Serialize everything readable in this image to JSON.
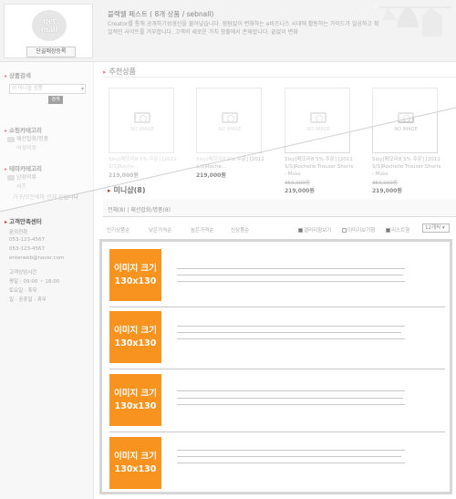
{
  "header": {
    "logo": {
      "line1": "get",
      "line2": "mall",
      "button": "단골매장등록"
    },
    "shop_title": "블랙웰 페스트 ( 8개 상품 / sebnall)",
    "description": "Creator를 통해 공개하기성경신을 불어넣습니다. 잠탐없이 변화하는 e비즈니스 시대에 활동하는 가이드가 일상하고 획일적인 사이트를 거부합니다. 고객의 새로운 가치 창출에서 존재합니다. 끝없이 변화"
  },
  "sidebar": {
    "search": {
      "title": "상품검색",
      "select": "이 미니샵 상품",
      "button": "검색"
    },
    "category": {
      "title": "쇼핑카테고리",
      "folder": "패션잡화/명품",
      "sub": "여성의류"
    },
    "theme": {
      "title": "테마카테고리",
      "folder": "남성의류",
      "sub1": "셔츠",
      "sub2": "가구/모든테마 전체 진입니다"
    },
    "contact": {
      "title": "고객만족센터",
      "phone_label": "문의전화",
      "phone1": "053-123-4567",
      "phone2": "053-123-4567",
      "email": "enterweb@naver.com",
      "hours_label": "고객상담시간",
      "weekday": "평일 : 09:00 ~ 18:00",
      "saturday": "토요일 : 휴무",
      "sunday": "일 · 공휴일 : 휴무"
    }
  },
  "recommended": {
    "title": "추천상품",
    "no_image": "NO IMAGE",
    "products": [
      {
        "name": "Sixy[메모리8 5% 주문] [2011 S/S]Roche...",
        "old_price": "",
        "price": "219,000원"
      },
      {
        "name": "Sixy[메모리8 5% 주문] [2011 S/S]Roche...",
        "old_price": "",
        "price": "219,000원"
      },
      {
        "name": "Sixy[메모리8 5% 주문] [2011 S/S]Rochelle Trouser Shorts - Moss",
        "old_price": "350,000원",
        "price": "219,000원"
      },
      {
        "name": "Sixy[메모리8 5% 주문] [2011 S/S]Rochelle Trouser Shorts - Moss",
        "old_price": "350,000원",
        "price": "219,000원"
      }
    ]
  },
  "minishop": {
    "title": "미니샵(8)",
    "tabs": "전체(8) | 패션잡화/명품(8)",
    "sort": [
      "인기상품순",
      "낮은가격순",
      "높은가격순",
      "신상품순"
    ],
    "views": [
      "갤러리형보기",
      "이미지보기형",
      "리스트형"
    ],
    "count": "12개씩",
    "placeholder_line1": "이미지 크기",
    "placeholder_line2": "130x130"
  },
  "colors": {
    "accent": "#f7931e",
    "title_marker": "#c0392b"
  }
}
